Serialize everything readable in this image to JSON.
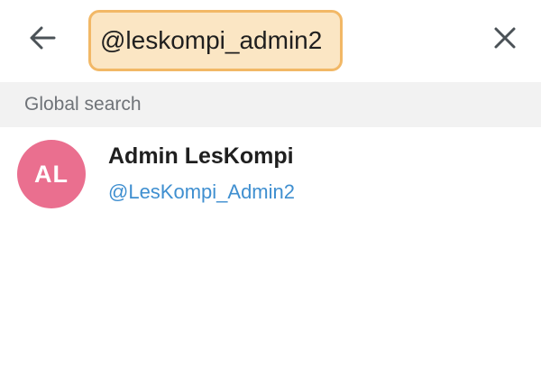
{
  "header": {
    "back_icon": "arrow-left-icon",
    "search_value": "@leskompi_admin2",
    "close_icon": "close-icon",
    "search_highlight_color": "#f2b866"
  },
  "section": {
    "title": "Global search"
  },
  "results": [
    {
      "avatar_initials": "AL",
      "avatar_color": "#ea6f8f",
      "name": "Admin LesKompi",
      "username": "@LesKompi_Admin2",
      "username_color": "#3f8fd0"
    }
  ]
}
